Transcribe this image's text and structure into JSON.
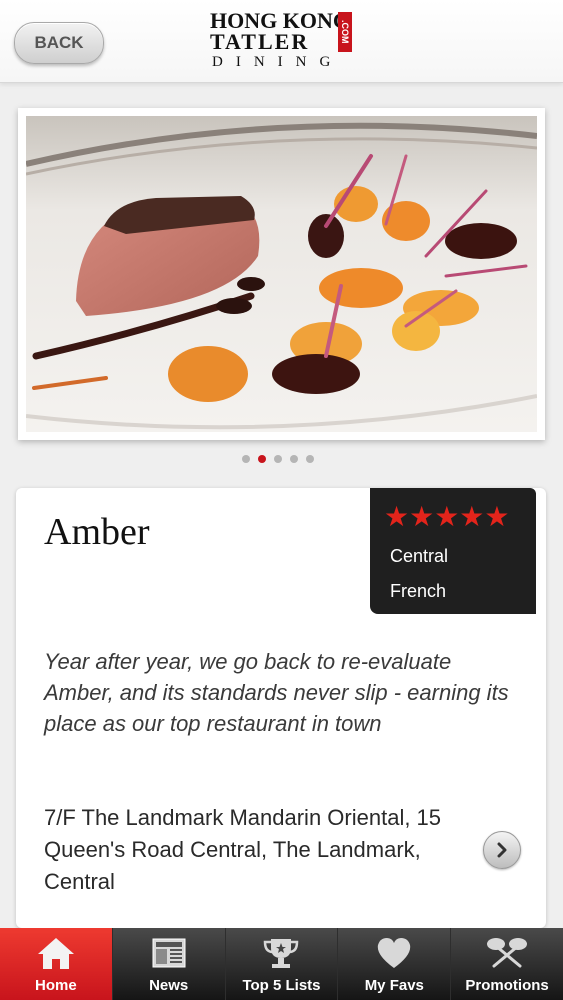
{
  "header": {
    "back_label": "BACK",
    "logo": {
      "line1": "HONG KONG",
      "line2": "TATLER",
      "com": ".COM",
      "line3": "DINING"
    }
  },
  "gallery": {
    "total": 5,
    "current": 2
  },
  "restaurant": {
    "name": "Amber",
    "rating": 5,
    "stars": "★★★★★",
    "district": "Central",
    "cuisine": "French",
    "description": "Year after year, we go back to re-evaluate Amber, and its standards never slip - earning its place as our top restaurant in town",
    "address": "7/F The Landmark Mandarin Oriental, 15 Queen's Road Central, The Landmark, Central"
  },
  "tabs": [
    {
      "label": "Home",
      "icon": "home-icon",
      "active": true
    },
    {
      "label": "News",
      "icon": "newspaper-icon",
      "active": false
    },
    {
      "label": "Top 5 Lists",
      "icon": "trophy-icon",
      "active": false
    },
    {
      "label": "My Favs",
      "icon": "heart-icon",
      "active": false
    },
    {
      "label": "Promotions",
      "icon": "cutlery-icon",
      "active": false
    }
  ],
  "colors": {
    "accent": "#c8141c",
    "star": "#e3241b",
    "info_bg": "#1f1f1f"
  }
}
